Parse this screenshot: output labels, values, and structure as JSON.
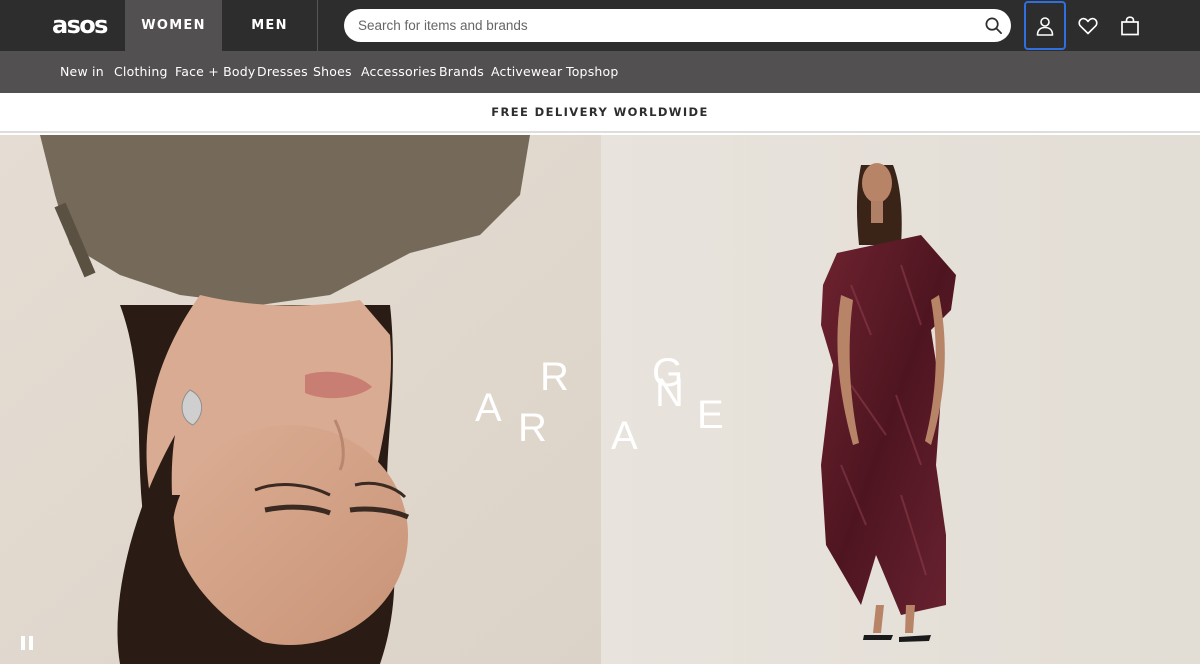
{
  "header": {
    "logo": "asos",
    "tabs": [
      {
        "label": "WOMEN",
        "active": true
      },
      {
        "label": "MEN",
        "active": false
      }
    ],
    "search_placeholder": "Search for items and brands",
    "icons": [
      "search-icon",
      "account-icon",
      "heart-icon",
      "bag-icon"
    ]
  },
  "categories": [
    "New in",
    "Clothing",
    "Face + Body",
    "Dresses",
    "Shoes",
    "Accessories",
    "Brands",
    "Activewear",
    "Topshop"
  ],
  "promo": "FREE DELIVERY WORLDWIDE",
  "hero": {
    "letters": [
      "A",
      "R",
      "R",
      "A",
      "G",
      "N",
      "E"
    ]
  },
  "colors": {
    "topbar": "#2d2d2d",
    "active_tab": "#525050",
    "category_bar": "#525050",
    "focus_ring": "#2f6fe0",
    "dress": "#5c1a26"
  }
}
